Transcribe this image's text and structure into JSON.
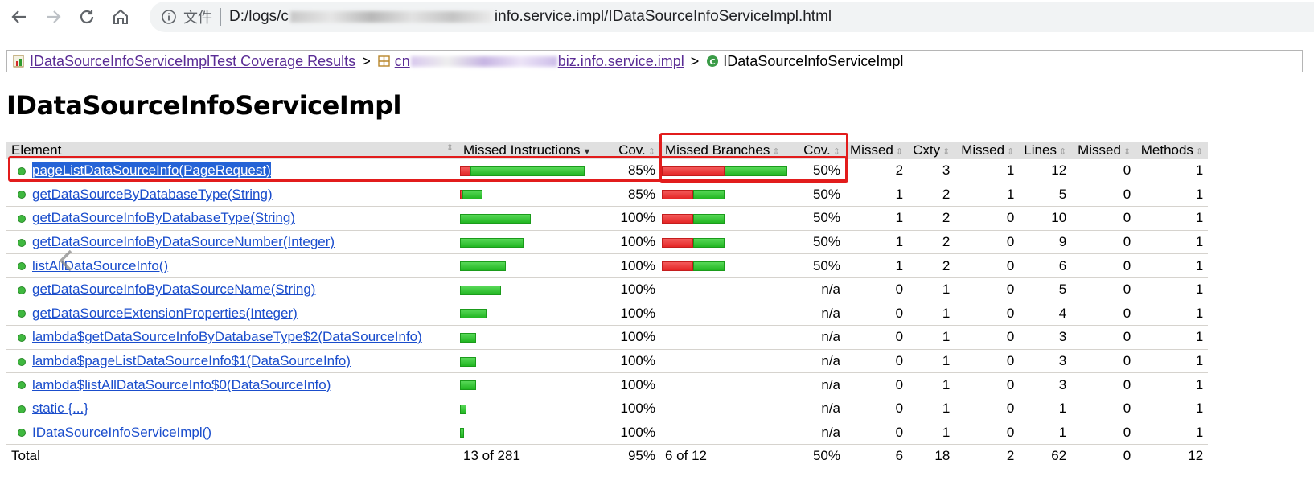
{
  "browser": {
    "site_chip": "文件",
    "url_prefix": "D:/logs/c",
    "url_suffix": "info.service.impl/IDataSourceInfoServiceImpl.html"
  },
  "breadcrumb": {
    "report_link": "IDataSourceInfoServiceImplTest Coverage Results",
    "package_prefix": "cn",
    "package_suffix": "biz.info.service.impl",
    "current": "IDataSourceInfoServiceImpl",
    "separator": ">"
  },
  "page": {
    "title": "IDataSourceInfoServiceImpl"
  },
  "table": {
    "headers": {
      "element": "Element",
      "missed_instructions": "Missed Instructions",
      "cov1": "Cov.",
      "missed_branches": "Missed Branches",
      "cov2": "Cov.",
      "missed_cxty": "Missed",
      "cxty": "Cxty",
      "missed_lines": "Missed",
      "lines": "Lines",
      "missed_methods": "Missed",
      "methods": "Methods"
    },
    "rows": [
      {
        "name": "pageListDataSourceInfo(PageRequest)",
        "instr_missed_frac": 0.085,
        "instr_total_frac": 1.0,
        "cov1": "85%",
        "br_missed_frac": 0.5,
        "br_total_frac": 1.0,
        "cov2": "50%",
        "mc": "2",
        "c": "3",
        "ml": "1",
        "l": "12",
        "mm": "0",
        "m": "1"
      },
      {
        "name": "getDataSourceByDatabaseType(String)",
        "instr_missed_frac": 0.022,
        "instr_total_frac": 0.18,
        "cov1": "85%",
        "br_missed_frac": 0.25,
        "br_total_frac": 0.5,
        "cov2": "50%",
        "mc": "1",
        "c": "2",
        "ml": "1",
        "l": "5",
        "mm": "0",
        "m": "1"
      },
      {
        "name": "getDataSourceInfoByDatabaseType(String)",
        "instr_missed_frac": 0,
        "instr_total_frac": 0.57,
        "cov1": "100%",
        "br_missed_frac": 0.25,
        "br_total_frac": 0.5,
        "cov2": "50%",
        "mc": "1",
        "c": "2",
        "ml": "0",
        "l": "10",
        "mm": "0",
        "m": "1"
      },
      {
        "name": "getDataSourceInfoByDataSourceNumber(Integer)",
        "instr_missed_frac": 0,
        "instr_total_frac": 0.51,
        "cov1": "100%",
        "br_missed_frac": 0.25,
        "br_total_frac": 0.5,
        "cov2": "50%",
        "mc": "1",
        "c": "2",
        "ml": "0",
        "l": "9",
        "mm": "0",
        "m": "1"
      },
      {
        "name": "listAllDataSourceInfo()",
        "instr_missed_frac": 0,
        "instr_total_frac": 0.37,
        "cov1": "100%",
        "br_missed_frac": 0.25,
        "br_total_frac": 0.5,
        "cov2": "50%",
        "mc": "1",
        "c": "2",
        "ml": "0",
        "l": "6",
        "mm": "0",
        "m": "1"
      },
      {
        "name": "getDataSourceInfoByDataSourceName(String)",
        "instr_missed_frac": 0,
        "instr_total_frac": 0.33,
        "cov1": "100%",
        "br_missed_frac": 0,
        "br_total_frac": 0,
        "cov2": "n/a",
        "mc": "0",
        "c": "1",
        "ml": "0",
        "l": "5",
        "mm": "0",
        "m": "1"
      },
      {
        "name": "getDataSourceExtensionProperties(Integer)",
        "instr_missed_frac": 0,
        "instr_total_frac": 0.21,
        "cov1": "100%",
        "br_missed_frac": 0,
        "br_total_frac": 0,
        "cov2": "n/a",
        "mc": "0",
        "c": "1",
        "ml": "0",
        "l": "4",
        "mm": "0",
        "m": "1"
      },
      {
        "name": "lambda$getDataSourceInfoByDatabaseType$2(DataSourceInfo)",
        "instr_missed_frac": 0,
        "instr_total_frac": 0.13,
        "cov1": "100%",
        "br_missed_frac": 0,
        "br_total_frac": 0,
        "cov2": "n/a",
        "mc": "0",
        "c": "1",
        "ml": "0",
        "l": "3",
        "mm": "0",
        "m": "1"
      },
      {
        "name": "lambda$pageListDataSourceInfo$1(DataSourceInfo)",
        "instr_missed_frac": 0,
        "instr_total_frac": 0.13,
        "cov1": "100%",
        "br_missed_frac": 0,
        "br_total_frac": 0,
        "cov2": "n/a",
        "mc": "0",
        "c": "1",
        "ml": "0",
        "l": "3",
        "mm": "0",
        "m": "1"
      },
      {
        "name": "lambda$listAllDataSourceInfo$0(DataSourceInfo)",
        "instr_missed_frac": 0,
        "instr_total_frac": 0.13,
        "cov1": "100%",
        "br_missed_frac": 0,
        "br_total_frac": 0,
        "cov2": "n/a",
        "mc": "0",
        "c": "1",
        "ml": "0",
        "l": "3",
        "mm": "0",
        "m": "1"
      },
      {
        "name": "static {...}",
        "instr_missed_frac": 0,
        "instr_total_frac": 0.05,
        "cov1": "100%",
        "br_missed_frac": 0,
        "br_total_frac": 0,
        "cov2": "n/a",
        "mc": "0",
        "c": "1",
        "ml": "0",
        "l": "1",
        "mm": "0",
        "m": "1"
      },
      {
        "name": "IDataSourceInfoServiceImpl()",
        "instr_missed_frac": 0,
        "instr_total_frac": 0.03,
        "cov1": "100%",
        "br_missed_frac": 0,
        "br_total_frac": 0,
        "cov2": "n/a",
        "mc": "0",
        "c": "1",
        "ml": "0",
        "l": "1",
        "mm": "0",
        "m": "1"
      }
    ],
    "total": {
      "label": "Total",
      "instructions": "13 of 281",
      "cov1": "95%",
      "branches": "6 of 12",
      "cov2": "50%",
      "mc": "6",
      "c": "18",
      "ml": "2",
      "l": "62",
      "mm": "0",
      "m": "12"
    }
  },
  "colors": {
    "missed": "#e52626",
    "covered": "#22b622",
    "highlight": "#e21c1c",
    "link": "#1a4dcc",
    "visited": "#5a2c95"
  }
}
